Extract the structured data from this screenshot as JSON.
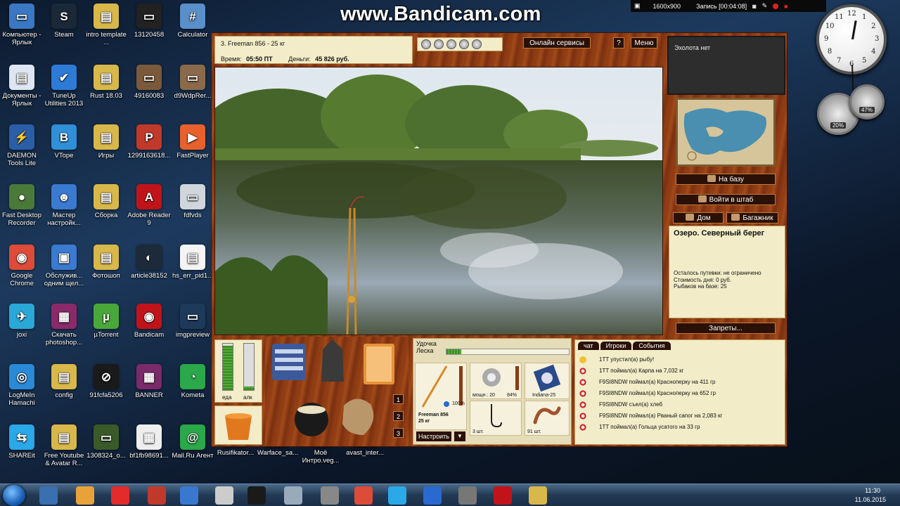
{
  "desktop": {
    "icons": [
      {
        "label": "Компьютер - Ярлык",
        "color": "#3b78c4",
        "glyph": "▭",
        "col": 0,
        "row": 0
      },
      {
        "label": "Steam",
        "color": "#1b2838",
        "glyph": "S",
        "col": 1,
        "row": 0
      },
      {
        "label": "intro template ...",
        "color": "#d8b84a",
        "glyph": "▤",
        "col": 2,
        "row": 0
      },
      {
        "label": "13120458",
        "color": "#222",
        "glyph": "▭",
        "col": 3,
        "row": 0
      },
      {
        "label": "Calculator",
        "color": "#5a8fc9",
        "glyph": "#",
        "col": 4,
        "row": 0
      },
      {
        "label": "Документы - Ярлык",
        "color": "#dde6f2",
        "glyph": "▤",
        "col": 0,
        "row": 1
      },
      {
        "label": "TuneUp Utilities 2013",
        "color": "#2d7bd6",
        "glyph": "✔",
        "col": 1,
        "row": 1
      },
      {
        "label": "Rust 18.03",
        "color": "#d8b84a",
        "glyph": "▤",
        "col": 2,
        "row": 1
      },
      {
        "label": "49160083",
        "color": "#7a5a3a",
        "glyph": "▭",
        "col": 3,
        "row": 1
      },
      {
        "label": "d9WdpRer...",
        "color": "#8a6a4a",
        "glyph": "▭",
        "col": 4,
        "row": 1
      },
      {
        "label": "DAEMON Tools Lite",
        "color": "#2a5fa8",
        "glyph": "⚡",
        "col": 0,
        "row": 2
      },
      {
        "label": "VTope",
        "color": "#2f8fd8",
        "glyph": "B",
        "col": 1,
        "row": 2
      },
      {
        "label": "Игры",
        "color": "#d8b84a",
        "glyph": "▤",
        "col": 2,
        "row": 2
      },
      {
        "label": "1299163618...",
        "color": "#c0392b",
        "glyph": "P",
        "col": 3,
        "row": 2
      },
      {
        "label": "FastPlayer",
        "color": "#e8612c",
        "glyph": "▶",
        "col": 4,
        "row": 2
      },
      {
        "label": "Fast Desktop Recorder",
        "color": "#4a7a3a",
        "glyph": "●",
        "col": 0,
        "row": 3
      },
      {
        "label": "Мастер настройк...",
        "color": "#3a7ad0",
        "glyph": "☻",
        "col": 1,
        "row": 3
      },
      {
        "label": "Сборка",
        "color": "#d8b84a",
        "glyph": "▤",
        "col": 2,
        "row": 3
      },
      {
        "label": "Adobe Reader 9",
        "color": "#c0141a",
        "glyph": "A",
        "col": 3,
        "row": 3
      },
      {
        "label": "fdfvds",
        "color": "#cfd6dc",
        "glyph": "▭",
        "col": 4,
        "row": 3
      },
      {
        "label": "Google Chrome",
        "color": "#dd4b39",
        "glyph": "◉",
        "col": 0,
        "row": 4
      },
      {
        "label": "Обслужив... одним щел...",
        "color": "#3a7ad0",
        "glyph": "▣",
        "col": 1,
        "row": 4
      },
      {
        "label": "Фотошоп",
        "color": "#d8b84a",
        "glyph": "▤",
        "col": 2,
        "row": 4
      },
      {
        "label": "article38152",
        "color": "#1d2a3a",
        "glyph": "◐",
        "col": 3,
        "row": 4
      },
      {
        "label": "hs_err_pid1...",
        "color": "#f4f4f4",
        "glyph": "▤",
        "col": 4,
        "row": 4
      },
      {
        "label": "joxi",
        "color": "#2aa8d8",
        "glyph": "✈",
        "col": 0,
        "row": 5
      },
      {
        "label": "Скачать photoshop...",
        "color": "#8a2a6a",
        "glyph": "▦",
        "col": 1,
        "row": 5
      },
      {
        "label": "µTorrent",
        "color": "#4aa83a",
        "glyph": "µ",
        "col": 2,
        "row": 5
      },
      {
        "label": "Bandicam",
        "color": "#c0141a",
        "glyph": "◉",
        "col": 3,
        "row": 5
      },
      {
        "label": "imgpreview",
        "color": "#1e3a5a",
        "glyph": "▭",
        "col": 4,
        "row": 5
      },
      {
        "label": "LogMeIn Hamachi",
        "color": "#2a8ad8",
        "glyph": "◎",
        "col": 0,
        "row": 6
      },
      {
        "label": "config",
        "color": "#d8b84a",
        "glyph": "▤",
        "col": 1,
        "row": 6
      },
      {
        "label": "91fcfa5206",
        "color": "#1a1a1a",
        "glyph": "⊘",
        "col": 2,
        "row": 6
      },
      {
        "label": "BANNER",
        "color": "#7a2a6a",
        "glyph": "▦",
        "col": 3,
        "row": 6
      },
      {
        "label": "Kometa",
        "color": "#2aa84a",
        "glyph": "◔",
        "col": 4,
        "row": 6
      },
      {
        "label": "SHAREit",
        "color": "#2aa8e8",
        "glyph": "⇆",
        "col": 0,
        "row": 7
      },
      {
        "label": "Free Youtube & Avatar R...",
        "color": "#d8b84a",
        "glyph": "▤",
        "col": 1,
        "row": 7
      },
      {
        "label": "1308324_o...",
        "color": "#3a5a2a",
        "glyph": "▭",
        "col": 2,
        "row": 7
      },
      {
        "label": "bf1fb98691...",
        "color": "#eee",
        "glyph": "▦",
        "col": 3,
        "row": 7
      },
      {
        "label": "Mail.Ru Агент",
        "color": "#2aa84a",
        "glyph": "@",
        "col": 4,
        "row": 7
      }
    ],
    "extra_icons": [
      {
        "label": "Rusifikator...",
        "color": "#2a5a8a"
      },
      {
        "label": "Warface_sa...",
        "color": "#444"
      },
      {
        "label": "Моё Интро.veg...",
        "color": "#eee"
      },
      {
        "label": "avast_inter...",
        "color": "#e86a1a"
      }
    ]
  },
  "recorder": {
    "watermark": "www.Bandicam.com",
    "resolution": "1600x900",
    "status": "Запись [00:04:08]"
  },
  "gadgets": {
    "clock_numbers": [
      "12",
      "1",
      "2",
      "3",
      "4",
      "5",
      "6",
      "7",
      "8",
      "9",
      "10",
      "11"
    ],
    "cpu": "20%",
    "ram": "47%"
  },
  "game": {
    "player": {
      "name": "3. Freeman 856 - 25 кг",
      "time_label": "Время:",
      "time_value": "05:50 ПТ",
      "money_label": "Деньги:",
      "money_value": "45 826 руб."
    },
    "top_buttons": {
      "online": "Онлайн сервисы",
      "help": "?",
      "menu": "Меню"
    },
    "echo": "Эхолота нет",
    "side_buttons": {
      "to_base": "На базу",
      "to_hq": "Войти в штаб",
      "home": "Дом",
      "trunk": "Багажник",
      "bans": "Запреты..."
    },
    "location": {
      "title": "Озеро. Северный берег",
      "voucher": "Осталось путевки: не ограничено",
      "cost": "Стоимость дня: 0 руб.",
      "fishers": "Рыбаков на базе: 25"
    },
    "stats": {
      "food_label": "еда",
      "alc_label": "алк",
      "food_level": 0.95,
      "alc_level": 0.08
    },
    "inventory_slots": [
      "1",
      "2",
      "3"
    ],
    "tackle": {
      "rod_label": "Удочка",
      "line_label": "Леска",
      "rod_name": "Freeman 856",
      "rod_weight": "25 кг",
      "rod_pct": "100%",
      "reel_power": "мощн.: 20",
      "reel_pct": "84%",
      "line_name": "Indiana-25",
      "hooks": "3 шт.",
      "bait": "91 шт.",
      "setup_btn": "Настроить",
      "dropdown": "▼"
    },
    "events": {
      "tabs": [
        "чат",
        "Игроки",
        "События"
      ],
      "items": [
        "1TT упустил(а) рыбу!",
        "1TT поймал(а) Карпа на 7,032 кг",
        "F9SI8NDW поймал(а) Красноперку на 411 гр",
        "F9SI8NDW поймал(а) Красноперку на 652 гр",
        "F9SI8NDW съел(а) хлеб",
        "F9SI8NDW поймал(а) Рваный сапог на 2,083 кг",
        "1TT поймал(а) Гольца усатого на 33 гр"
      ]
    }
  },
  "taskbar": {
    "apps": [
      "#3a6fb0",
      "#e8a23a",
      "#e32b2b",
      "#c0392b",
      "#3a78d0",
      "#ccc",
      "#1a1a1a",
      "#9ab",
      "#888",
      "#dd4b39",
      "#2aa8e8",
      "#2a6ad0",
      "#777",
      "#c0141a",
      "#d8b84a"
    ],
    "time": "11:30",
    "date": "11.06.2015"
  }
}
